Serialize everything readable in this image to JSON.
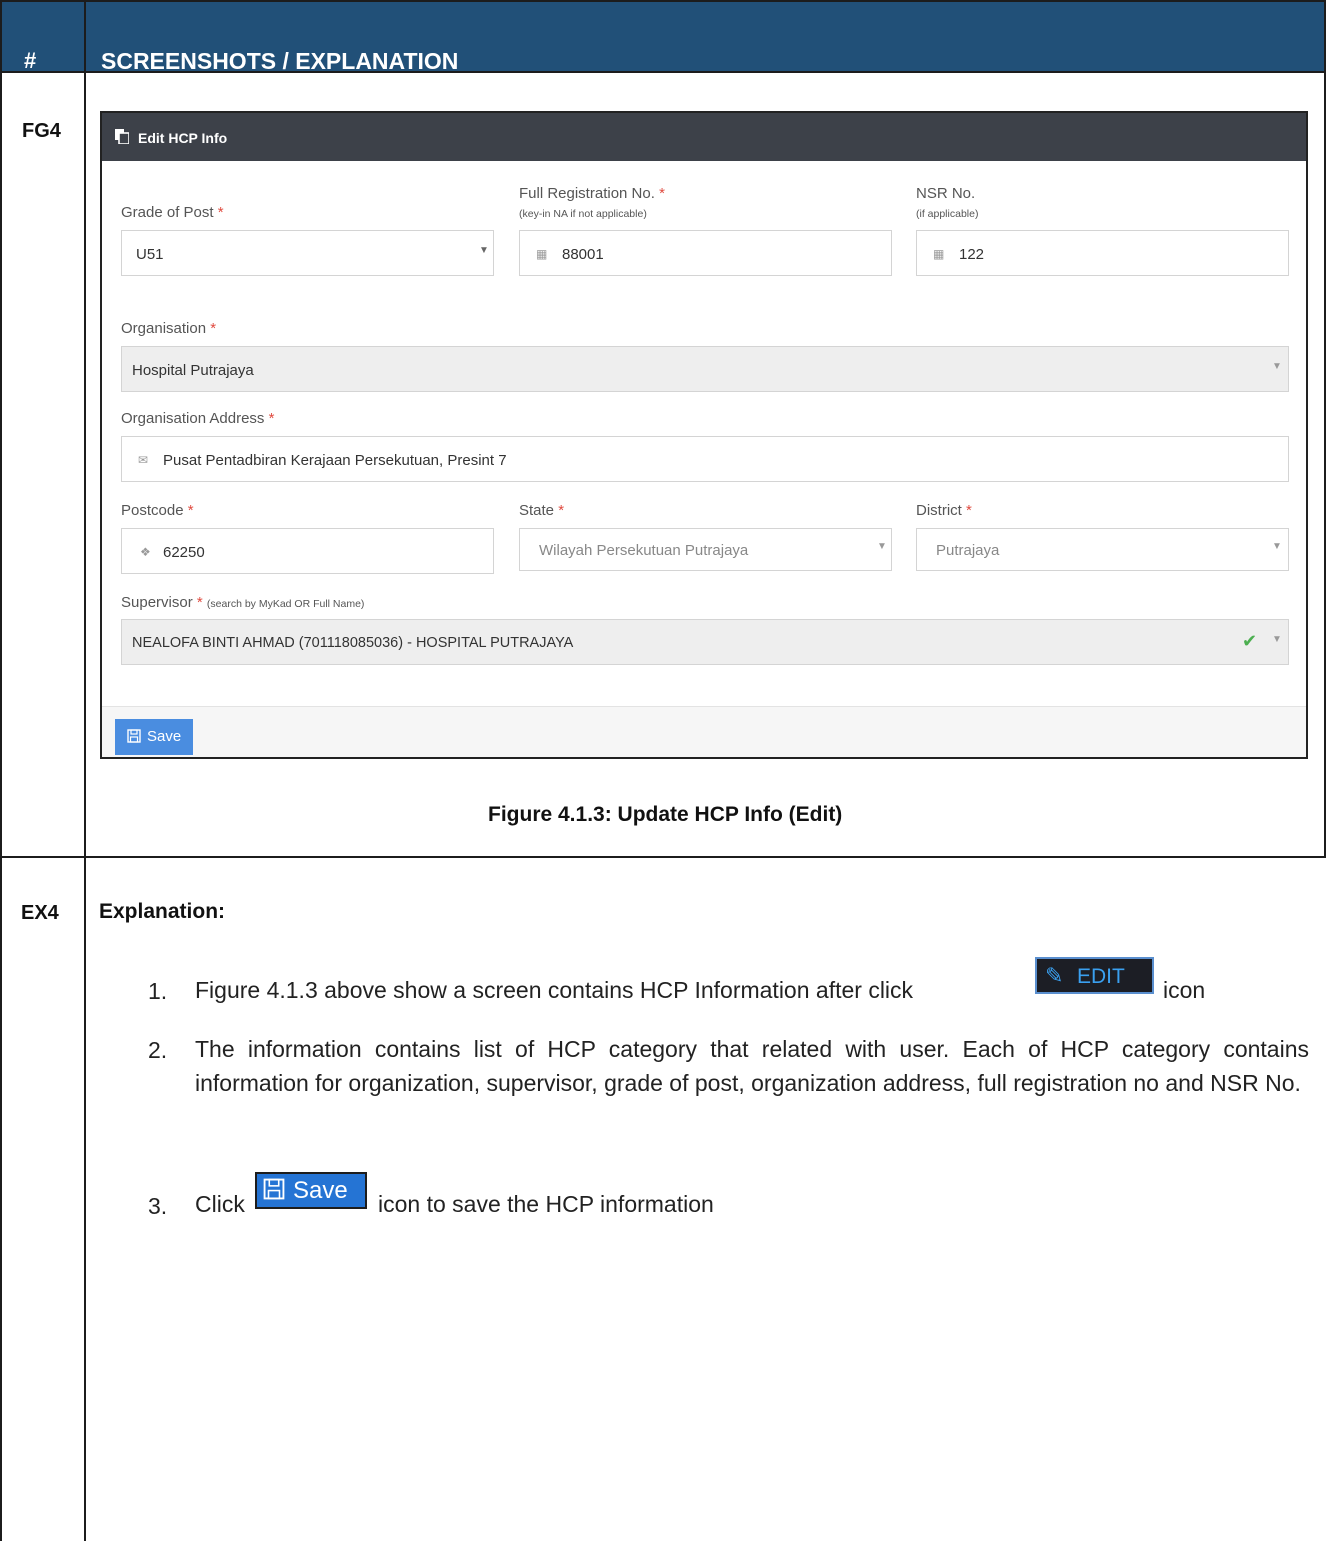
{
  "header": {
    "num": "#",
    "title": "SCREENSHOTS / EXPLANATION"
  },
  "rows": {
    "fg": "FG4",
    "ex": "EX4"
  },
  "panel": {
    "title": "Edit HCP Info",
    "grade": {
      "label": "Grade of Post",
      "required": "*",
      "value": "U51"
    },
    "full_reg": {
      "label": "Full Registration No.",
      "required": "*",
      "hint": "(key-in NA if not applicable)",
      "value": "88001"
    },
    "nsr": {
      "label": "NSR No.",
      "hint": "(if applicable)",
      "value": "122"
    },
    "organisation": {
      "label": "Organisation",
      "required": "*",
      "value": "Hospital Putrajaya"
    },
    "org_address": {
      "label": "Organisation Address",
      "required": "*",
      "value": "Pusat Pentadbiran Kerajaan Persekutuan, Presint 7"
    },
    "postcode": {
      "label": "Postcode",
      "required": "*",
      "value": "62250"
    },
    "state": {
      "label": "State",
      "required": "*",
      "value": "Wilayah Persekutuan Putrajaya"
    },
    "district": {
      "label": "District",
      "required": "*",
      "value": "Putrajaya"
    },
    "supervisor": {
      "label": "Supervisor",
      "required": "*",
      "hint": "(search by MyKad OR Full Name)",
      "value": "NEALOFA BINTI AHMAD (701118085036) - HOSPITAL PUTRAJAYA"
    },
    "save_label": "Save"
  },
  "caption": "Figure 4.1.3: Update HCP Info (Edit)",
  "explanation": {
    "title": "Explanation:",
    "items": [
      {
        "num": "1.",
        "before": "Figure 4.1.3 above show a screen contains HCP Information after click",
        "after": "icon"
      },
      {
        "num": "2.",
        "text": "The information contains list of HCP category that related with user. Each of HCP category contains information for organization, supervisor, grade of post, organization address, full registration no and NSR No."
      },
      {
        "num": "3.",
        "before": "Click",
        "after": "icon to save the HCP information"
      }
    ],
    "edit_button_label": "EDIT",
    "save_button_label": "Save"
  },
  "colors": {
    "header_bg": "#215078",
    "panel_head_bg": "#3d4149",
    "required": "#e04a3f",
    "save_btn": "#4a8de0",
    "check": "#4caf50"
  }
}
